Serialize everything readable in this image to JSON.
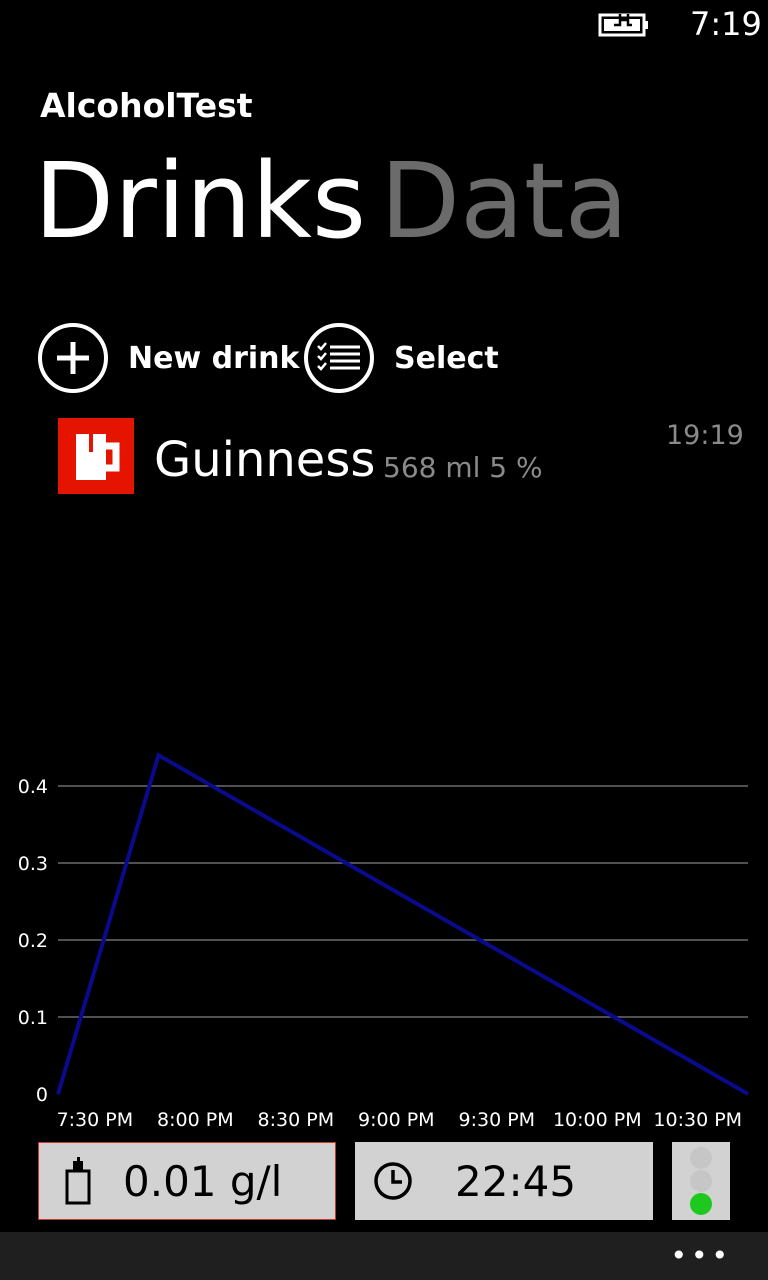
{
  "status_bar": {
    "time": "7:19",
    "battery_icon": "battery-charging-icon"
  },
  "app": {
    "title": "AlcoholTest"
  },
  "pivot": {
    "items": [
      {
        "label": "Drinks",
        "active": true
      },
      {
        "label": "Data",
        "active": false
      }
    ]
  },
  "actions": {
    "new_drink": {
      "label": "New drink",
      "icon": "plus-circle-icon"
    },
    "select": {
      "label": "Select",
      "icon": "checklist-icon"
    }
  },
  "drinks": [
    {
      "name": "Guinness",
      "details": "568 ml 5 %",
      "time": "19:19",
      "icon": "mug-icon",
      "tile_color": "#e51400"
    }
  ],
  "chart_data": {
    "type": "line",
    "x_ticks": [
      "7:30 PM",
      "8:00 PM",
      "8:30 PM",
      "9:00 PM",
      "9:30 PM",
      "10:00 PM",
      "10:30 PM"
    ],
    "y_ticks": [
      "0",
      "0.1",
      "0.2",
      "0.3",
      "0.4"
    ],
    "ylim": [
      0,
      0.4
    ],
    "grid": true,
    "line_color": "#0a0a8c",
    "series": [
      {
        "x": [
          "7:19 PM",
          "7:49 PM",
          "10:45 PM"
        ],
        "y": [
          0,
          0.44,
          0
        ]
      }
    ]
  },
  "summary": {
    "bac_value": "0.01 g/l",
    "sober_time": "22:45",
    "bac_icon": "bottle-icon",
    "time_icon": "clock-icon",
    "traffic_light": {
      "red": false,
      "yellow": false,
      "green": true
    }
  },
  "app_bar": {
    "more_label": "•••"
  }
}
